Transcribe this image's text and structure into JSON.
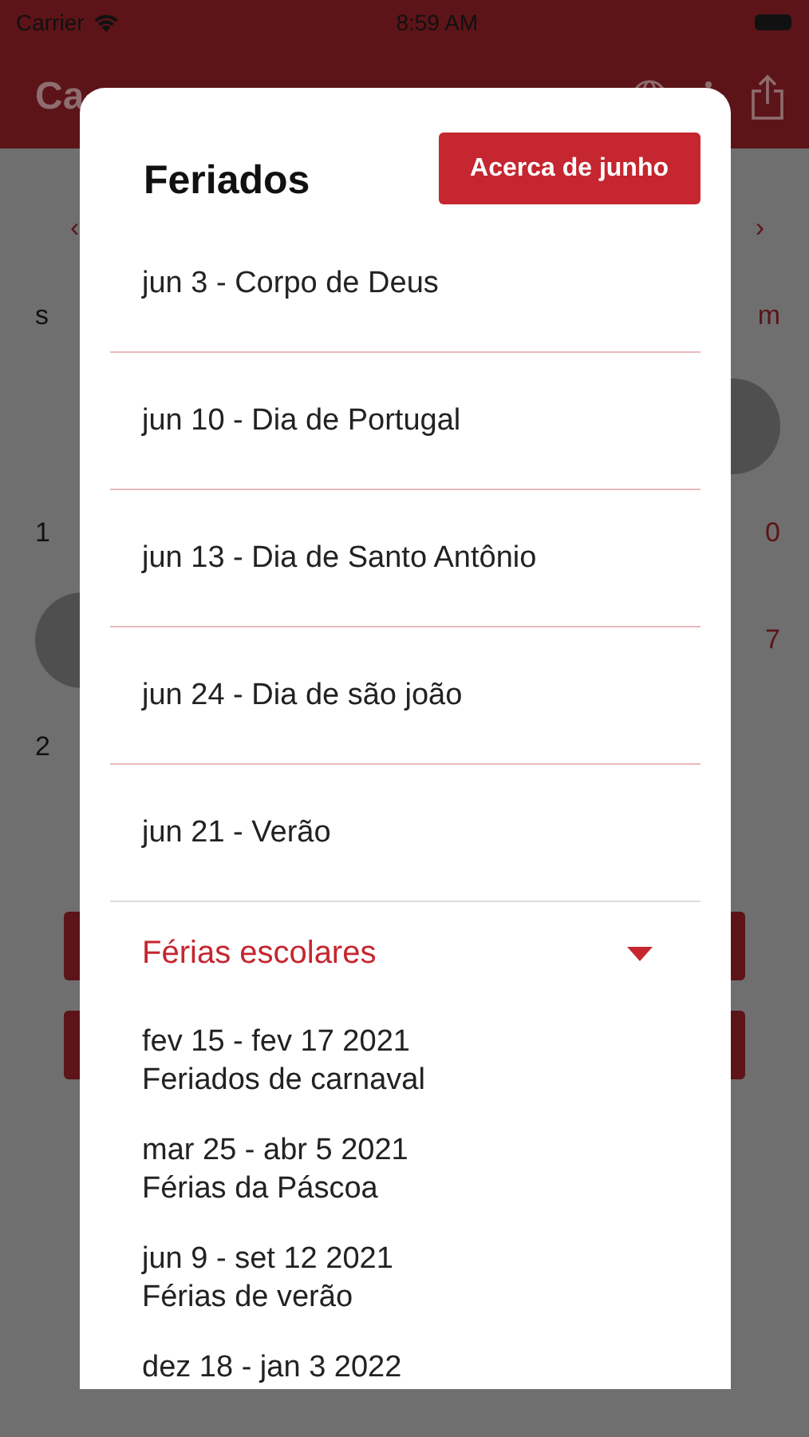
{
  "status_bar": {
    "carrier": "Carrier",
    "time": "8:59 AM"
  },
  "app_bar": {
    "title": "Ca"
  },
  "background": {
    "nav": {
      "prev": "‹",
      "next": "›"
    },
    "rows": [
      {
        "cells": [
          {
            "kind": "text",
            "text": "s",
            "color": "#111111"
          },
          {
            "kind": "text",
            "text": "m",
            "color": "#5c1418"
          }
        ]
      },
      {
        "cells": [
          {
            "kind": "blank"
          },
          {
            "kind": "circle"
          }
        ]
      },
      {
        "cells": [
          {
            "kind": "text",
            "text": "1",
            "color": "#111111"
          },
          {
            "kind": "text",
            "text": "0",
            "color": "#5c1418"
          }
        ]
      },
      {
        "cells": [
          {
            "kind": "circle"
          },
          {
            "kind": "text",
            "text": "7",
            "color": "#5c1418"
          }
        ]
      },
      {
        "cells": [
          {
            "kind": "text",
            "text": "2",
            "color": "#111111"
          },
          {
            "kind": "blank"
          }
        ]
      }
    ]
  },
  "dialog": {
    "title": "Feriados",
    "action": "Acerca de junho",
    "holidays": [
      {
        "text": "jun 3 - Corpo de Deus"
      },
      {
        "text": "jun 10 - Dia de Portugal"
      },
      {
        "text": "jun 13 - Dia de Santo Antônio"
      },
      {
        "text": "jun 24 - Dia de são joão"
      },
      {
        "text": "jun 21 - Verão"
      }
    ],
    "section": {
      "title": "Férias escolares",
      "expanded": true,
      "items": [
        {
          "dates": "fev 15 - fev 17 2021",
          "name": "Feriados de carnaval"
        },
        {
          "dates": "mar 25 - abr 5 2021",
          "name": "Férias da Páscoa"
        },
        {
          "dates": "jun 9 - set 12 2021",
          "name": "Férias de verão"
        },
        {
          "dates": "dez 18 - jan 3 2022"
        }
      ]
    }
  }
}
